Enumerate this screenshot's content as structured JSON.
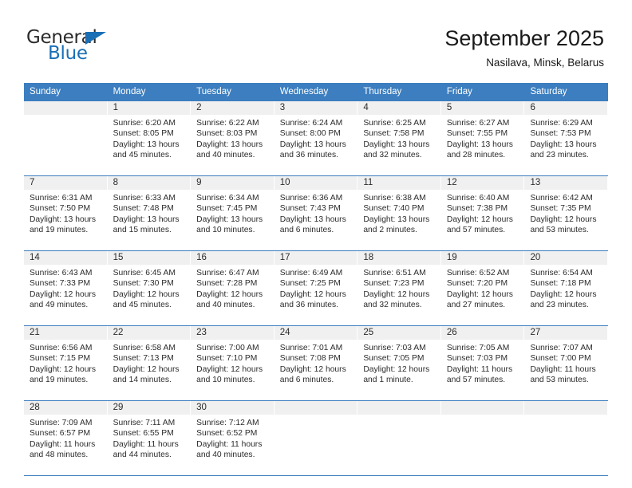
{
  "brand": {
    "name_part1": "General",
    "name_part2": "Blue",
    "accent_color": "#1a6fb5"
  },
  "header": {
    "title": "September 2025",
    "subtitle": "Nasilava, Minsk, Belarus"
  },
  "calendar": {
    "header_color": "#3c7ebf",
    "daynumber_band_color": "#f0f0f0",
    "weekdays": [
      "Sunday",
      "Monday",
      "Tuesday",
      "Wednesday",
      "Thursday",
      "Friday",
      "Saturday"
    ],
    "weeks": [
      [
        {
          "day": "",
          "sunrise": "",
          "sunset": "",
          "daylight": "",
          "daylight2": "",
          "empty": true
        },
        {
          "day": "1",
          "sunrise": "Sunrise: 6:20 AM",
          "sunset": "Sunset: 8:05 PM",
          "daylight": "Daylight: 13 hours",
          "daylight2": "and 45 minutes."
        },
        {
          "day": "2",
          "sunrise": "Sunrise: 6:22 AM",
          "sunset": "Sunset: 8:03 PM",
          "daylight": "Daylight: 13 hours",
          "daylight2": "and 40 minutes."
        },
        {
          "day": "3",
          "sunrise": "Sunrise: 6:24 AM",
          "sunset": "Sunset: 8:00 PM",
          "daylight": "Daylight: 13 hours",
          "daylight2": "and 36 minutes."
        },
        {
          "day": "4",
          "sunrise": "Sunrise: 6:25 AM",
          "sunset": "Sunset: 7:58 PM",
          "daylight": "Daylight: 13 hours",
          "daylight2": "and 32 minutes."
        },
        {
          "day": "5",
          "sunrise": "Sunrise: 6:27 AM",
          "sunset": "Sunset: 7:55 PM",
          "daylight": "Daylight: 13 hours",
          "daylight2": "and 28 minutes."
        },
        {
          "day": "6",
          "sunrise": "Sunrise: 6:29 AM",
          "sunset": "Sunset: 7:53 PM",
          "daylight": "Daylight: 13 hours",
          "daylight2": "and 23 minutes."
        }
      ],
      [
        {
          "day": "7",
          "sunrise": "Sunrise: 6:31 AM",
          "sunset": "Sunset: 7:50 PM",
          "daylight": "Daylight: 13 hours",
          "daylight2": "and 19 minutes."
        },
        {
          "day": "8",
          "sunrise": "Sunrise: 6:33 AM",
          "sunset": "Sunset: 7:48 PM",
          "daylight": "Daylight: 13 hours",
          "daylight2": "and 15 minutes."
        },
        {
          "day": "9",
          "sunrise": "Sunrise: 6:34 AM",
          "sunset": "Sunset: 7:45 PM",
          "daylight": "Daylight: 13 hours",
          "daylight2": "and 10 minutes."
        },
        {
          "day": "10",
          "sunrise": "Sunrise: 6:36 AM",
          "sunset": "Sunset: 7:43 PM",
          "daylight": "Daylight: 13 hours",
          "daylight2": "and 6 minutes."
        },
        {
          "day": "11",
          "sunrise": "Sunrise: 6:38 AM",
          "sunset": "Sunset: 7:40 PM",
          "daylight": "Daylight: 13 hours",
          "daylight2": "and 2 minutes."
        },
        {
          "day": "12",
          "sunrise": "Sunrise: 6:40 AM",
          "sunset": "Sunset: 7:38 PM",
          "daylight": "Daylight: 12 hours",
          "daylight2": "and 57 minutes."
        },
        {
          "day": "13",
          "sunrise": "Sunrise: 6:42 AM",
          "sunset": "Sunset: 7:35 PM",
          "daylight": "Daylight: 12 hours",
          "daylight2": "and 53 minutes."
        }
      ],
      [
        {
          "day": "14",
          "sunrise": "Sunrise: 6:43 AM",
          "sunset": "Sunset: 7:33 PM",
          "daylight": "Daylight: 12 hours",
          "daylight2": "and 49 minutes."
        },
        {
          "day": "15",
          "sunrise": "Sunrise: 6:45 AM",
          "sunset": "Sunset: 7:30 PM",
          "daylight": "Daylight: 12 hours",
          "daylight2": "and 45 minutes."
        },
        {
          "day": "16",
          "sunrise": "Sunrise: 6:47 AM",
          "sunset": "Sunset: 7:28 PM",
          "daylight": "Daylight: 12 hours",
          "daylight2": "and 40 minutes."
        },
        {
          "day": "17",
          "sunrise": "Sunrise: 6:49 AM",
          "sunset": "Sunset: 7:25 PM",
          "daylight": "Daylight: 12 hours",
          "daylight2": "and 36 minutes."
        },
        {
          "day": "18",
          "sunrise": "Sunrise: 6:51 AM",
          "sunset": "Sunset: 7:23 PM",
          "daylight": "Daylight: 12 hours",
          "daylight2": "and 32 minutes."
        },
        {
          "day": "19",
          "sunrise": "Sunrise: 6:52 AM",
          "sunset": "Sunset: 7:20 PM",
          "daylight": "Daylight: 12 hours",
          "daylight2": "and 27 minutes."
        },
        {
          "day": "20",
          "sunrise": "Sunrise: 6:54 AM",
          "sunset": "Sunset: 7:18 PM",
          "daylight": "Daylight: 12 hours",
          "daylight2": "and 23 minutes."
        }
      ],
      [
        {
          "day": "21",
          "sunrise": "Sunrise: 6:56 AM",
          "sunset": "Sunset: 7:15 PM",
          "daylight": "Daylight: 12 hours",
          "daylight2": "and 19 minutes."
        },
        {
          "day": "22",
          "sunrise": "Sunrise: 6:58 AM",
          "sunset": "Sunset: 7:13 PM",
          "daylight": "Daylight: 12 hours",
          "daylight2": "and 14 minutes."
        },
        {
          "day": "23",
          "sunrise": "Sunrise: 7:00 AM",
          "sunset": "Sunset: 7:10 PM",
          "daylight": "Daylight: 12 hours",
          "daylight2": "and 10 minutes."
        },
        {
          "day": "24",
          "sunrise": "Sunrise: 7:01 AM",
          "sunset": "Sunset: 7:08 PM",
          "daylight": "Daylight: 12 hours",
          "daylight2": "and 6 minutes."
        },
        {
          "day": "25",
          "sunrise": "Sunrise: 7:03 AM",
          "sunset": "Sunset: 7:05 PM",
          "daylight": "Daylight: 12 hours",
          "daylight2": "and 1 minute."
        },
        {
          "day": "26",
          "sunrise": "Sunrise: 7:05 AM",
          "sunset": "Sunset: 7:03 PM",
          "daylight": "Daylight: 11 hours",
          "daylight2": "and 57 minutes."
        },
        {
          "day": "27",
          "sunrise": "Sunrise: 7:07 AM",
          "sunset": "Sunset: 7:00 PM",
          "daylight": "Daylight: 11 hours",
          "daylight2": "and 53 minutes."
        }
      ],
      [
        {
          "day": "28",
          "sunrise": "Sunrise: 7:09 AM",
          "sunset": "Sunset: 6:57 PM",
          "daylight": "Daylight: 11 hours",
          "daylight2": "and 48 minutes."
        },
        {
          "day": "29",
          "sunrise": "Sunrise: 7:11 AM",
          "sunset": "Sunset: 6:55 PM",
          "daylight": "Daylight: 11 hours",
          "daylight2": "and 44 minutes."
        },
        {
          "day": "30",
          "sunrise": "Sunrise: 7:12 AM",
          "sunset": "Sunset: 6:52 PM",
          "daylight": "Daylight: 11 hours",
          "daylight2": "and 40 minutes."
        },
        {
          "day": "",
          "sunrise": "",
          "sunset": "",
          "daylight": "",
          "daylight2": "",
          "empty": true
        },
        {
          "day": "",
          "sunrise": "",
          "sunset": "",
          "daylight": "",
          "daylight2": "",
          "empty": true
        },
        {
          "day": "",
          "sunrise": "",
          "sunset": "",
          "daylight": "",
          "daylight2": "",
          "empty": true
        },
        {
          "day": "",
          "sunrise": "",
          "sunset": "",
          "daylight": "",
          "daylight2": "",
          "empty": true
        }
      ]
    ]
  }
}
